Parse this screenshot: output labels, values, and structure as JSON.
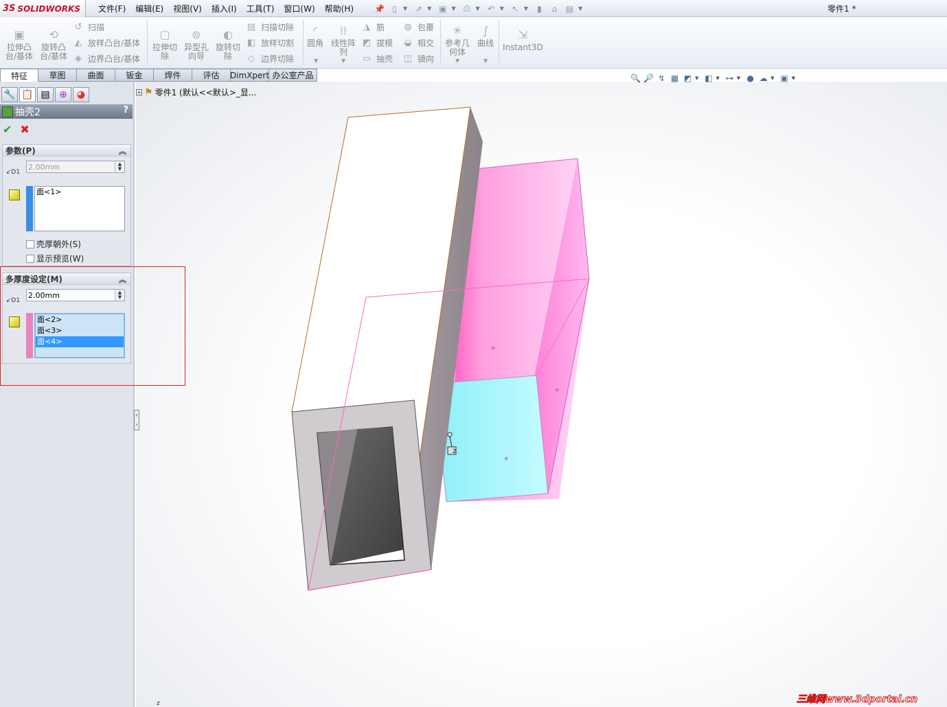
{
  "app": {
    "logo_ds": "3S",
    "logo_name": "SOLIDWORKS",
    "doc_title": "零件1 *"
  },
  "menu": {
    "items": [
      "文件(F)",
      "编辑(E)",
      "视图(V)",
      "插入(I)",
      "工具(T)",
      "窗口(W)",
      "帮助(H)"
    ]
  },
  "ribbon": {
    "extrude_boss": "拉伸凸\n台/基体",
    "revolve_boss": "旋转凸\n台/基体",
    "sweep": "扫描",
    "loft_boss": "放样凸台/基体",
    "boundary_boss": "边界凸台/基体",
    "extrude_cut": "拉伸切\n除",
    "hole_wizard": "异型孔\n向导",
    "revolve_cut": "旋转切\n除",
    "swept_cut": "扫描切除",
    "lofted_cut": "放样切割",
    "boundary_cut": "边界切除",
    "fillet": "圆角",
    "linear_pattern": "线性阵\n列",
    "rib": "筋",
    "draft": "拔模",
    "shell": "抽壳",
    "wrap": "包覆",
    "intersect": "相交",
    "mirror": "镜向",
    "ref_geometry": "参考几\n何体",
    "curves": "曲线",
    "instant3d": "Instant3D"
  },
  "tabs": [
    "特征",
    "草图",
    "曲面",
    "钣金",
    "焊件",
    "评估",
    "DimXpert",
    "办公室产品"
  ],
  "property_manager": {
    "title": "抽壳2",
    "help": "?",
    "params": {
      "header": "参数(P)",
      "thickness": "2.00mm",
      "faces": [
        "面<1>"
      ],
      "shell_outward": "壳厚朝外(S)",
      "show_preview": "显示预览(W)"
    },
    "multi": {
      "header": "多厚度设定(M)",
      "thickness": "2.00mm",
      "faces": [
        "面<2>",
        "面<3>",
        "面<4>"
      ],
      "selected_index": 2
    }
  },
  "tree": {
    "root": "零件1 (默认<<默认>_显..."
  },
  "viewport": {
    "callout_value": "2"
  },
  "watermark": "三维网www.3dportal.cn",
  "triad_axis": "z",
  "colors": {
    "pink_faces": "#ff88dd",
    "cyan_face": "#7ff0f8",
    "shell_gray": "#cfcfcf"
  }
}
